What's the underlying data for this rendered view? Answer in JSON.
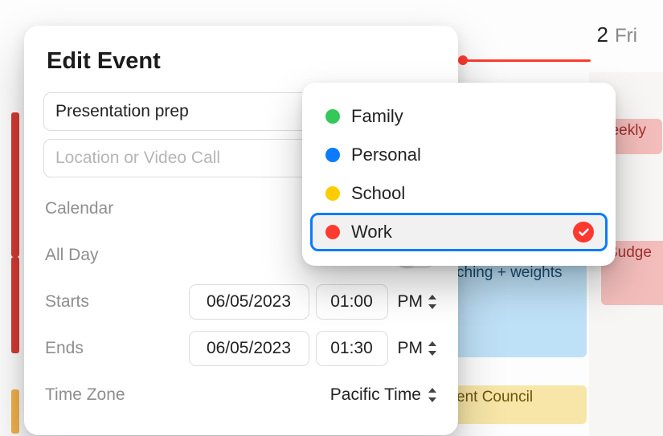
{
  "header": {
    "day_number": "2",
    "day_name": "Fri"
  },
  "background_events": {
    "stretching": "ching + weights",
    "budget": "Budge",
    "council": "ent Council",
    "weekly": "Weekly"
  },
  "edit": {
    "title": "Edit Event",
    "event_name": "Presentation prep",
    "location_placeholder": "Location or Video Call",
    "labels": {
      "calendar": "Calendar",
      "all_day": "All Day",
      "starts": "Starts",
      "ends": "Ends",
      "time_zone": "Time Zone"
    },
    "starts": {
      "date": "06/05/2023",
      "time": "01:00",
      "meridiem": "PM"
    },
    "ends": {
      "date": "06/05/2023",
      "time": "01:30",
      "meridiem": "PM"
    },
    "time_zone_value": "Pacific Time"
  },
  "dropdown": {
    "items": [
      {
        "label": "Family",
        "color": "#34c759"
      },
      {
        "label": "Personal",
        "color": "#0a7bff"
      },
      {
        "label": "School",
        "color": "#ffcc00"
      },
      {
        "label": "Work",
        "color": "#ff3b30"
      }
    ],
    "selected_index": 3
  }
}
